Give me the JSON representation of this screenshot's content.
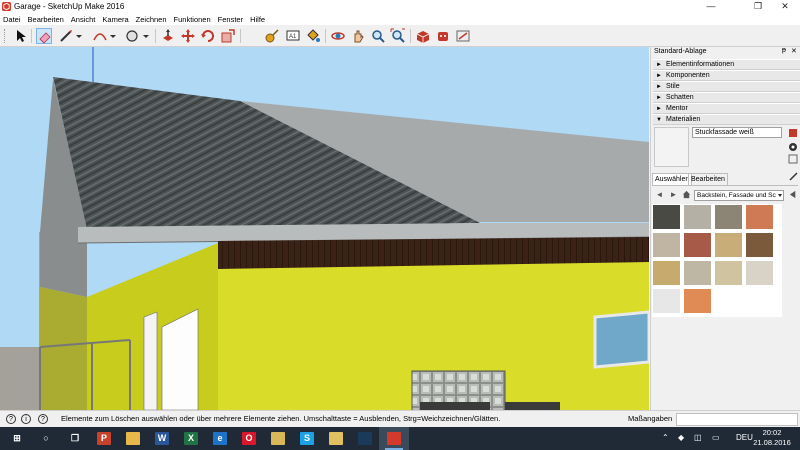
{
  "window": {
    "title": "Garage - SketchUp Make 2016",
    "controls": {
      "minimize": "—",
      "maximize": "❐",
      "close": "✕"
    }
  },
  "menu": [
    "Datei",
    "Bearbeiten",
    "Ansicht",
    "Kamera",
    "Zeichnen",
    "Funktionen",
    "Fenster",
    "Hilfe"
  ],
  "toolbar": {
    "tools": [
      "select-tool",
      "eraser-tool",
      "line-tool",
      "arc-tool",
      "shape-tool",
      "push-pull-tool",
      "move-tool",
      "rotate-tool",
      "scale-tool",
      "tape-measure-tool",
      "text-tool",
      "paint-bucket-tool",
      "orbit-tool",
      "pan-tool",
      "zoom-tool",
      "zoom-extents-tool",
      "3d-warehouse-tool",
      "extension-warehouse-tool",
      "layout-tool"
    ],
    "active_tool": "eraser-tool"
  },
  "tray": {
    "title": "Standard-Ablage",
    "pin": "ᵽ",
    "close": "✕",
    "panels": [
      {
        "label": "Elementinformationen",
        "expanded": false
      },
      {
        "label": "Komponenten",
        "expanded": false
      },
      {
        "label": "Stile",
        "expanded": false
      },
      {
        "label": "Schatten",
        "expanded": false
      },
      {
        "label": "Mentor",
        "expanded": false
      },
      {
        "label": "Materialien",
        "expanded": true
      }
    ],
    "collapsed_arrow": "►",
    "expanded_arrow": "▼"
  },
  "materials": {
    "current_name": "Stuckfassade weiß",
    "tabs": [
      "Auswählen",
      "Bearbeiten"
    ],
    "selected_tab": "Auswählen",
    "category": "Backstein, Fassade und Sc",
    "swatch_colors": [
      [
        "#4a4a44",
        "#b5b0a6",
        "#8c8576",
        "#d07a55"
      ],
      [
        "#bfb5a2",
        "#a85a48",
        "#c9ad78",
        "#7a5a3a"
      ],
      [
        "#c7ab6e",
        "#bdb7a3",
        "#cfc3a0",
        "#d8d3c6"
      ],
      [
        "#e7e7e7",
        "#e08a55"
      ]
    ]
  },
  "status": {
    "hint": "Elemente zum Löschen auswählen oder über mehrere Elemente ziehen. Umschalttaste = Ausblenden, Strg=Weichzeichnen/Glätten.",
    "measure_label": "Maßangaben",
    "measure_value": ""
  },
  "taskbar": {
    "apps": [
      {
        "name": "start",
        "glyph": "⊞",
        "color": "#1f2a36"
      },
      {
        "name": "search",
        "glyph": "○",
        "color": "#1f2a36"
      },
      {
        "name": "task-view",
        "glyph": "❐",
        "color": "#1f2a36"
      },
      {
        "name": "powerpoint",
        "glyph": "P",
        "color": "#c8412a"
      },
      {
        "name": "folder",
        "glyph": "",
        "color": "#e8b84a"
      },
      {
        "name": "word",
        "glyph": "W",
        "color": "#2b579a"
      },
      {
        "name": "excel",
        "glyph": "X",
        "color": "#217346"
      },
      {
        "name": "edge",
        "glyph": "e",
        "color": "#1e73c8"
      },
      {
        "name": "opera",
        "glyph": "O",
        "color": "#d8182a"
      },
      {
        "name": "photos",
        "glyph": "",
        "color": "#d9b85a"
      },
      {
        "name": "skype",
        "glyph": "S",
        "color": "#1da1e6"
      },
      {
        "name": "explorer",
        "glyph": "",
        "color": "#e0c060"
      },
      {
        "name": "steam",
        "glyph": "",
        "color": "#1b3a5a"
      },
      {
        "name": "sketchup",
        "glyph": "",
        "color": "#d33a2c"
      }
    ],
    "language": "DEU",
    "time": "20:02",
    "date": "21.08.2016"
  }
}
